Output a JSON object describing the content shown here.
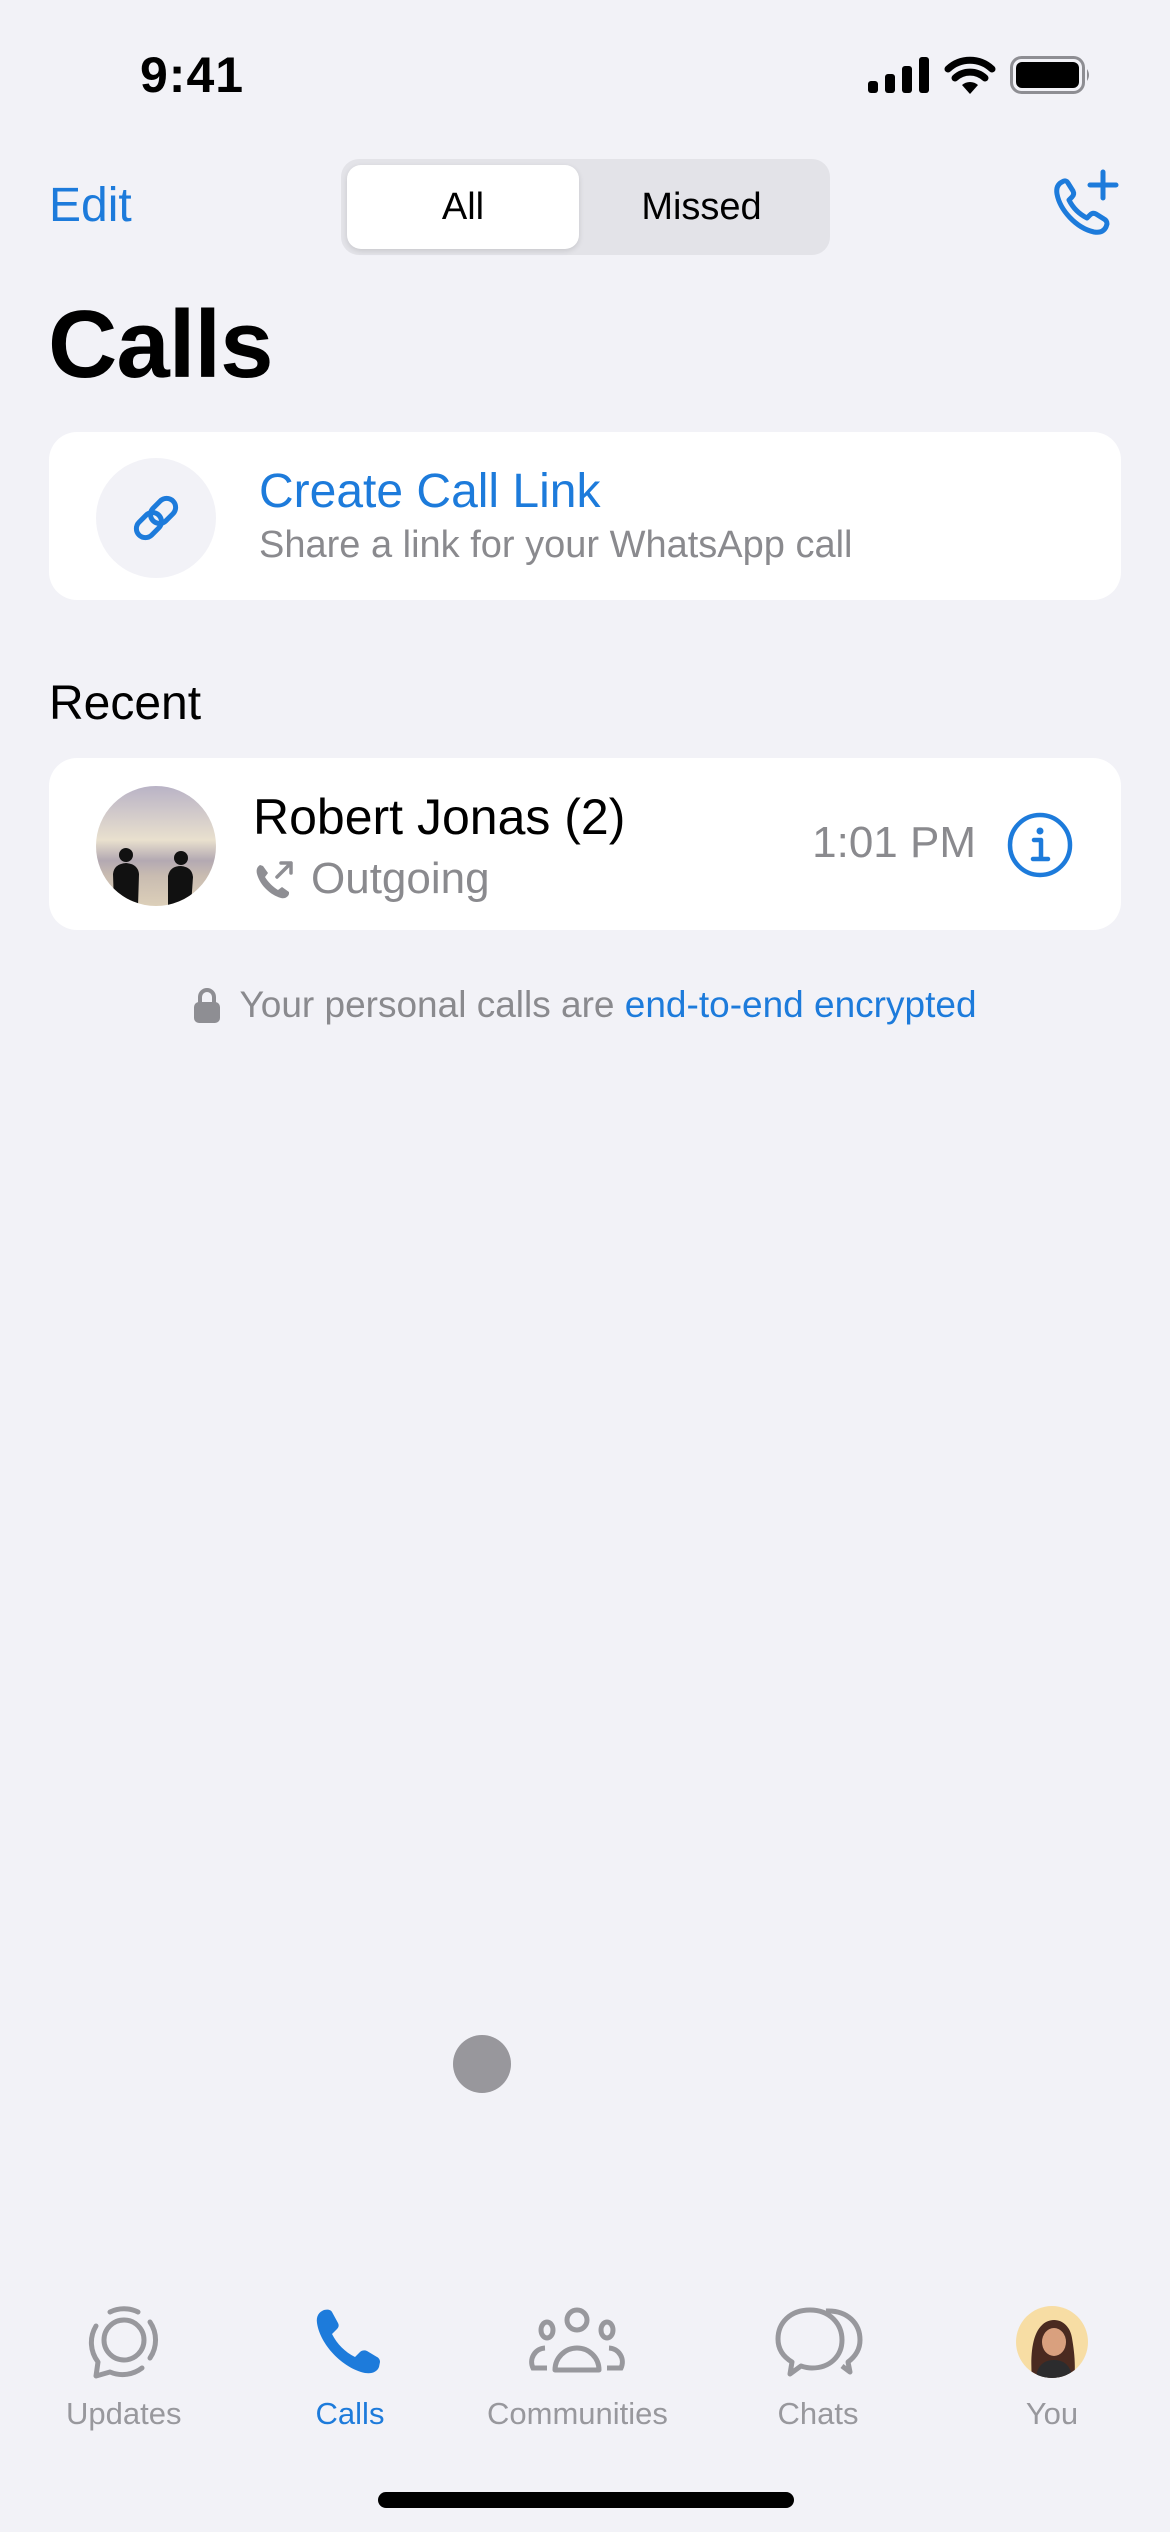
{
  "status_bar": {
    "time": "9:41",
    "icons": [
      "cellular-signal-icon",
      "wifi-icon",
      "battery-icon"
    ]
  },
  "nav": {
    "edit_label": "Edit",
    "segments": [
      {
        "label": "All",
        "selected": true
      },
      {
        "label": "Missed",
        "selected": false
      }
    ],
    "new_call_icon": "phone-plus-icon"
  },
  "page_title": "Calls",
  "call_link": {
    "icon": "link-icon",
    "title": "Create Call Link",
    "subtitle": "Share a link for your WhatsApp call"
  },
  "recent": {
    "section_label": "Recent",
    "calls": [
      {
        "name": "Robert Jonas (2)",
        "direction_icon": "outgoing-call-icon",
        "type": "Outgoing",
        "time": "1:01 PM",
        "info_icon": "info-icon"
      }
    ]
  },
  "encryption": {
    "prefix": "Your personal calls are",
    "link": "end-to-end encrypted",
    "icon": "lock-icon"
  },
  "tabbar": {
    "tabs": [
      {
        "label": "Updates",
        "icon": "updates-icon",
        "active": false
      },
      {
        "label": "Calls",
        "icon": "phone-icon",
        "active": true
      },
      {
        "label": "Communities",
        "icon": "communities-icon",
        "active": false
      },
      {
        "label": "Chats",
        "icon": "chats-icon",
        "active": false
      },
      {
        "label": "You",
        "icon": "profile-avatar",
        "active": false
      }
    ]
  },
  "colors": {
    "accent": "#1D7BDB",
    "background": "#F2F2F7",
    "secondary_text": "#8A8A8E",
    "inactive_tab": "#98989D"
  }
}
